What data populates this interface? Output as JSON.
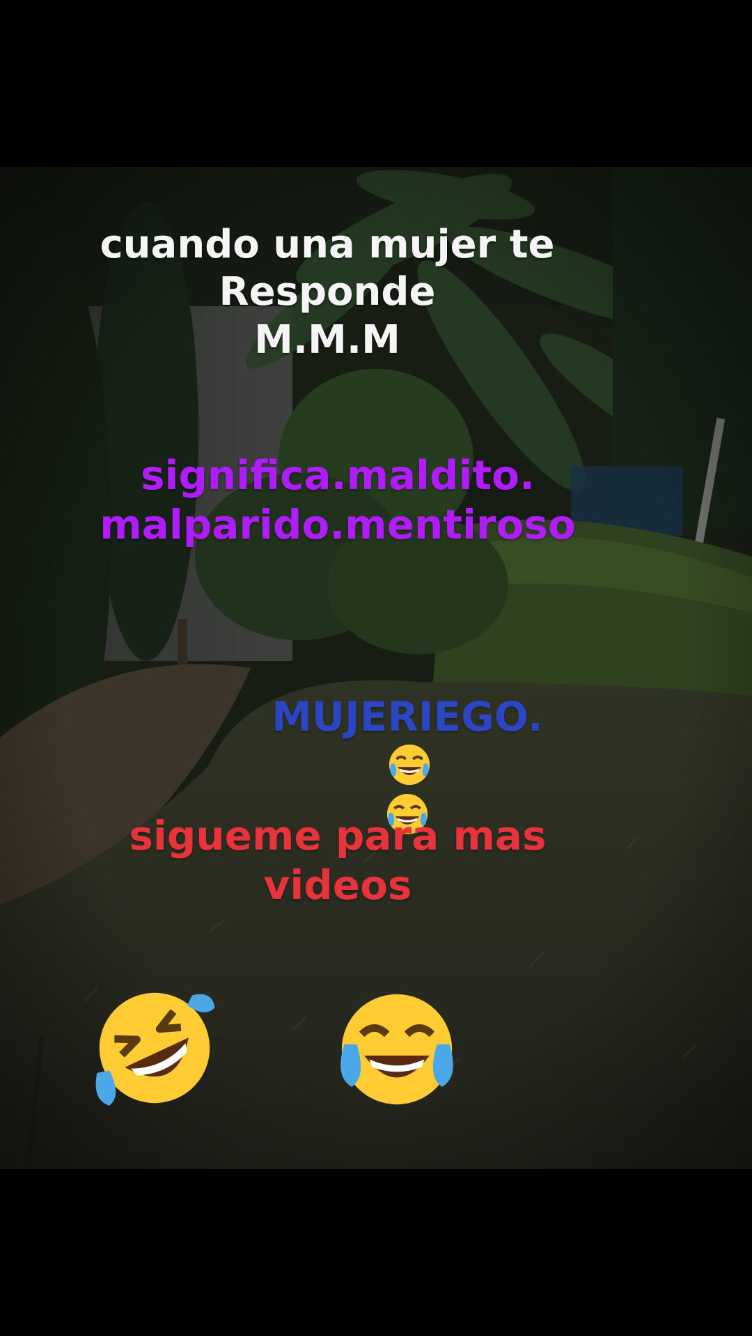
{
  "captions": {
    "line1": "cuando una mujer te\nResponde\nM.M.M",
    "line2": "significa.maldito.\nmalparido.mentiroso",
    "line3_text": "MUJERIEGO.",
    "line4": "sigueme para mas\nvideos"
  },
  "emojis": {
    "inline": [
      "face-with-tears-of-joy-icon",
      "face-with-tears-of-joy-icon"
    ],
    "bottom": [
      "rolling-on-floor-laughing-icon",
      "face-with-tears-of-joy-icon"
    ]
  },
  "colors": {
    "caption_white": "#f5f5f5",
    "caption_purple": "#b11cff",
    "caption_blue": "#2c45c2",
    "caption_red": "#e8323c",
    "letterbox": "#000000"
  }
}
